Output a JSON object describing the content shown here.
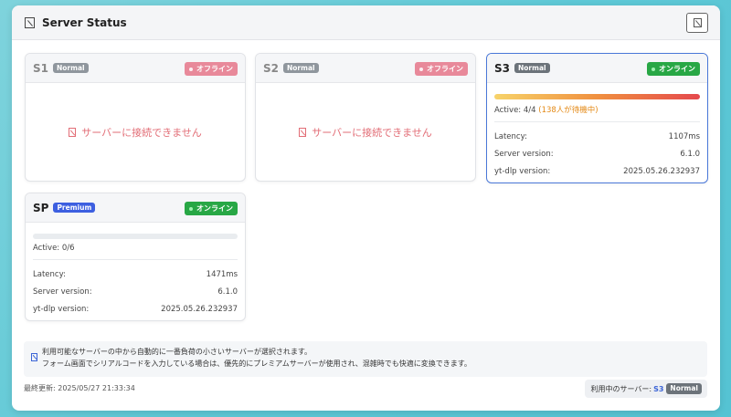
{
  "window": {
    "title": "Server Status"
  },
  "servers": [
    {
      "name": "S1",
      "tier": "Normal",
      "status": "オフライン",
      "message": "サーバーに接続できません"
    },
    {
      "name": "S2",
      "tier": "Normal",
      "status": "オフライン",
      "message": "サーバーに接続できません"
    },
    {
      "name": "S3",
      "tier": "Normal",
      "status": "オンライン",
      "active_label": "Active: 4/4",
      "waiting": "(138人が待機中)",
      "load_fraction": 1.0,
      "latency_label": "Latency:",
      "latency": "1107ms",
      "server_version_label": "Server version:",
      "server_version": "6.1.0",
      "ytdlp_version_label": "yt-dlp version:",
      "ytdlp_version": "2025.05.26.232937"
    },
    {
      "name": "SP",
      "tier": "Premium",
      "status": "オンライン",
      "active_label": "Active: 0/6",
      "load_fraction": 0.0,
      "latency_label": "Latency:",
      "latency": "1471ms",
      "server_version_label": "Server version:",
      "server_version": "6.1.0",
      "ytdlp_version_label": "yt-dlp version:",
      "ytdlp_version": "2025.05.26.232937"
    }
  ],
  "info": {
    "line1": "利用可能なサーバーの中から自動的に一番負荷の小さいサーバーが選択されます。",
    "line2": "フォーム画面でシリアルコードを入力している場合は、優先的にプレミアムサーバーが使用され、混雑時でも快適に変換できます。"
  },
  "footer": {
    "last_updated": "最終更新: 2025/05/27 21:33:34",
    "using_label": "利用中のサーバー:",
    "using_server": "S3",
    "using_tier": "Normal"
  },
  "colors": {
    "online": "#28a745",
    "offline": "#e8899a",
    "active_border": "#4a78d8",
    "premium": "#3d5fe0",
    "accent": "#3b64d6"
  },
  "icons": {
    "title": "server-icon",
    "close": "close-icon",
    "info": "info-icon",
    "offline": "disconnect-icon"
  }
}
